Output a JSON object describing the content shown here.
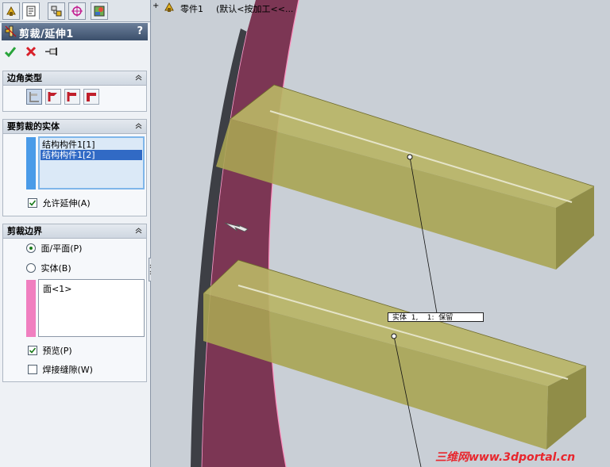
{
  "tabs": [
    {
      "icon": "feature-manager-icon"
    },
    {
      "icon": "property-manager-icon"
    },
    {
      "icon": "configuration-manager-icon"
    },
    {
      "icon": "dimxpert-icon"
    },
    {
      "icon": "display-manager-icon"
    }
  ],
  "panel": {
    "title": "剪裁/延伸1",
    "help": "?"
  },
  "corner": {
    "header": "边角类型"
  },
  "bodies": {
    "header": "要剪裁的实体",
    "items": [
      "结构构件1[1]",
      "结构构件1[2]"
    ],
    "selected_index": 1,
    "allow_extend_label": "允许延伸(A)",
    "allow_extend_checked": true
  },
  "boundary": {
    "header": "剪裁边界",
    "face_plane_label": "面/平面(P)",
    "body_label": "实体(B)",
    "selected_option": "face_plane",
    "list_items": [
      "面<1>"
    ],
    "preview_label": "预览(P)",
    "preview_checked": true,
    "weld_gap_label": "焊接缝隙(W)",
    "weld_gap_checked": false
  },
  "tree": {
    "expand": "+",
    "part_name": "零件1",
    "config_text": "(默认<按加工<<..."
  },
  "callout": {
    "text": "实体  1,    1:  保留"
  },
  "watermark": "三维网www.3dportal.cn",
  "colors": {
    "ring": "#7c3654",
    "ring_edge": "#ff8fbf",
    "beam": "#a8a453",
    "beam_dark": "#7f7b36",
    "background": "#c9cfd6"
  }
}
